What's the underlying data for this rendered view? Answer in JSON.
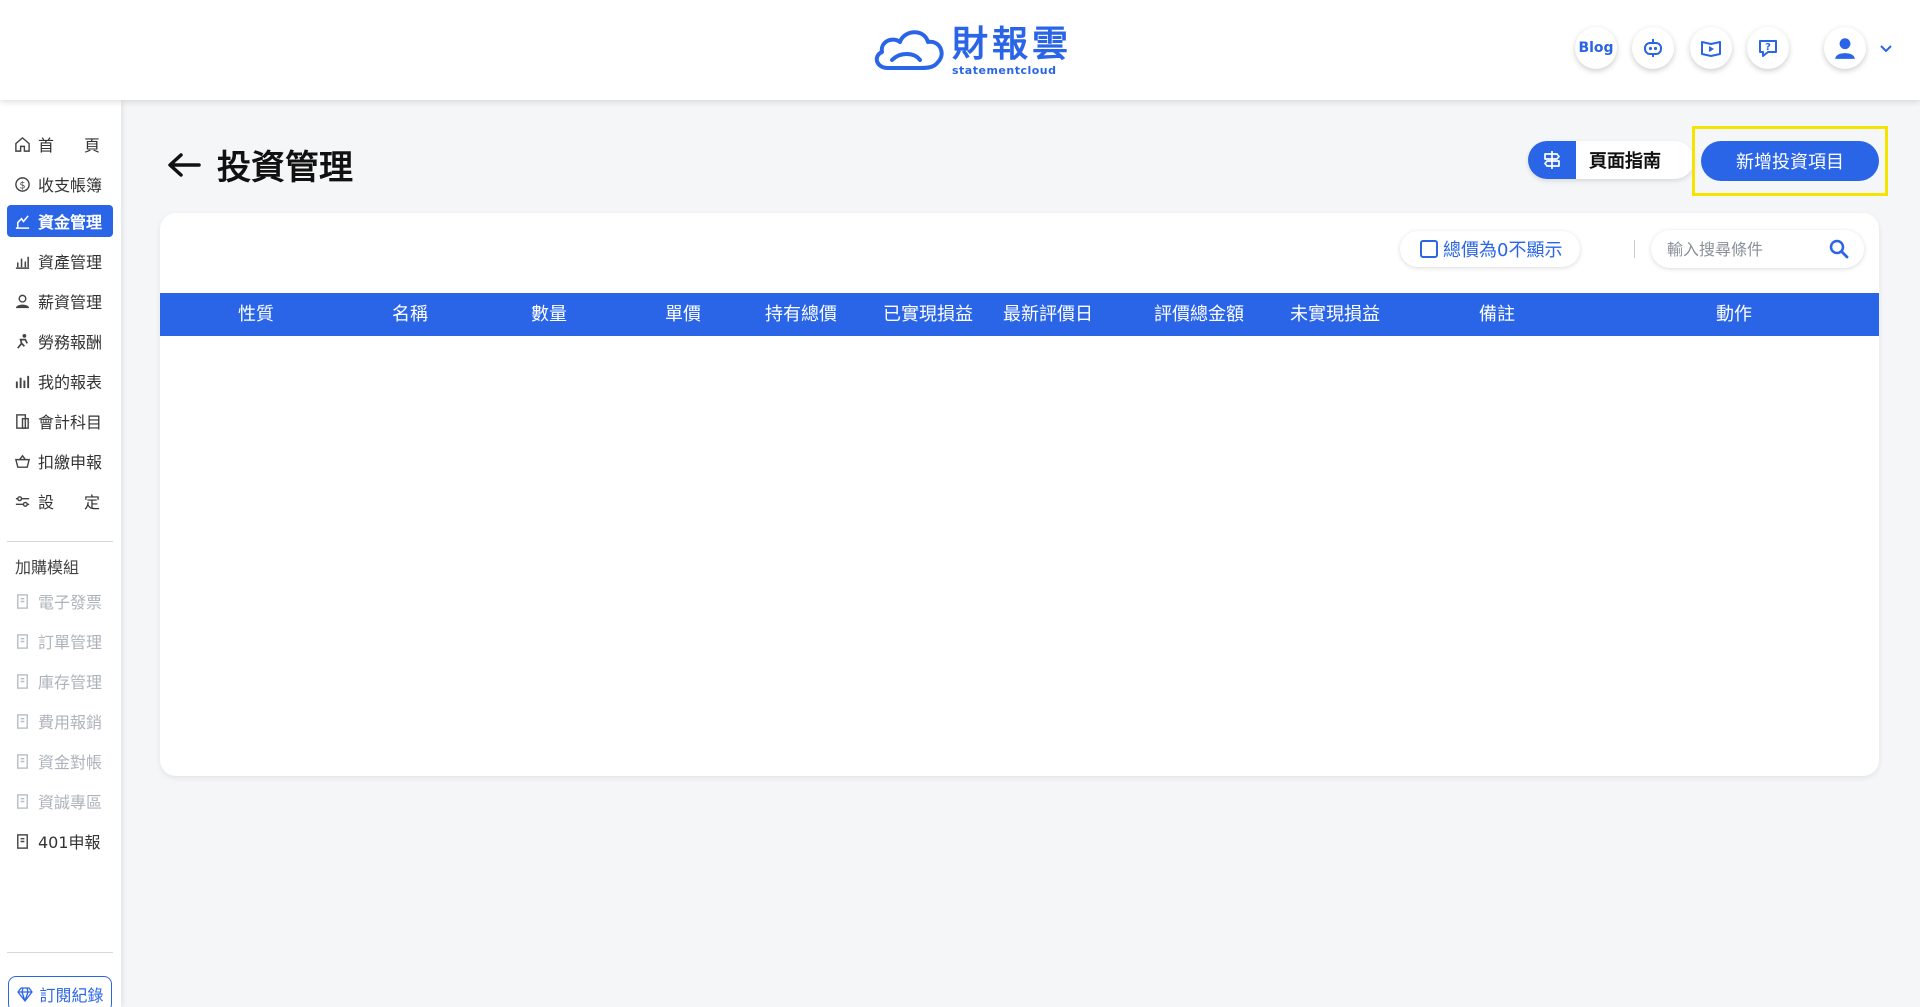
{
  "brand": {
    "name": "財報雲",
    "sub": "statementcloud"
  },
  "header": {
    "blog_label": "Blog"
  },
  "sidebar": {
    "items": [
      {
        "label_a": "首",
        "label_b": "頁",
        "icon": "home-icon"
      },
      {
        "label": "收支帳簿",
        "icon": "coin-icon"
      },
      {
        "label": "資金管理",
        "icon": "fund-icon"
      },
      {
        "label": "資產管理",
        "icon": "asset-chart-icon"
      },
      {
        "label": "薪資管理",
        "icon": "salary-icon"
      },
      {
        "label": "勞務報酬",
        "icon": "runner-icon"
      },
      {
        "label": "我的報表",
        "icon": "bar-chart-icon"
      },
      {
        "label": "會計科目",
        "icon": "ledger-icon"
      },
      {
        "label": "扣繳申報",
        "icon": "basket-icon"
      },
      {
        "label_a": "設",
        "label_b": "定",
        "icon": "sliders-icon"
      }
    ],
    "addon_title": "加購模組",
    "addons": [
      {
        "label": "電子發票",
        "icon": "module-icon"
      },
      {
        "label": "訂單管理",
        "icon": "module-icon"
      },
      {
        "label": "庫存管理",
        "icon": "module-icon"
      },
      {
        "label": "費用報銷",
        "icon": "module-icon"
      },
      {
        "label": "資金對帳",
        "icon": "module-icon"
      },
      {
        "label": "資誠專區",
        "icon": "module-icon"
      },
      {
        "label": "401申報",
        "icon": "module-icon"
      }
    ],
    "subscription_label": "訂閱紀錄"
  },
  "page": {
    "title": "投資管理",
    "guide_label": "頁面指南",
    "add_button": "新增投資項目"
  },
  "filters": {
    "hide_zero_label": "總價為0不顯示",
    "search_placeholder": "輸入搜尋條件"
  },
  "table": {
    "columns": [
      "性質",
      "名稱",
      "數量",
      "單價",
      "持有總價",
      "已實現損益",
      "最新評價日",
      "評價總金額",
      "未實現損益",
      "備註",
      "動作"
    ],
    "rows": []
  },
  "colors": {
    "accent": "#2a65e8",
    "highlight": "#f5e400"
  }
}
